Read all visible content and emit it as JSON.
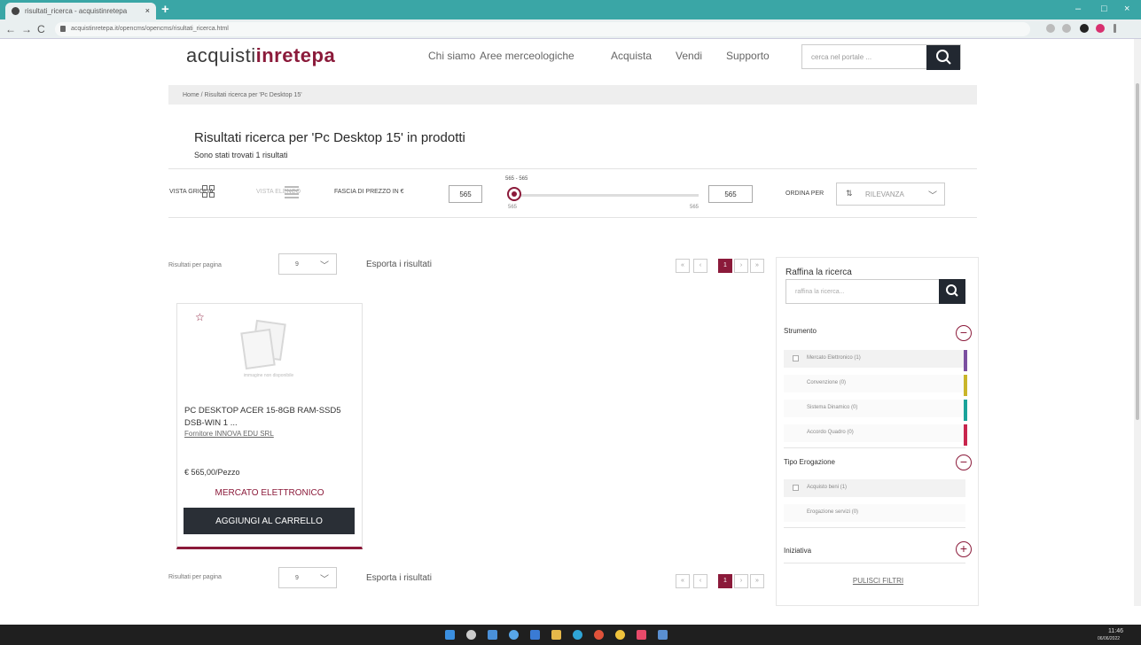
{
  "browser": {
    "tab_title": "risultati_ricerca - acquistinretepa",
    "tab_close": "×",
    "new_tab": "+",
    "url": "acquistinretepa.it/opencms/opencms/risultati_ricerca.html",
    "back": "←",
    "forward": "→",
    "reload": "C",
    "min": "–",
    "max": "□",
    "close": "×"
  },
  "header": {
    "logo_prefix": "acquisti",
    "logo_bold": "inrete",
    "logo_suffix": "pa",
    "nav": [
      "Chi siamo",
      "Aree merceologiche",
      "Acquista",
      "Vendi",
      "Supporto"
    ],
    "search_placeholder": "cerca nel portale ..."
  },
  "breadcrumb": "Home  /  Risultati ricerca per 'Pc Desktop 15'",
  "results": {
    "title": "Risultati ricerca per 'Pc Desktop 15' in prodotti",
    "subtitle": "Sono stati trovati 1 risultati"
  },
  "toolbar": {
    "grid_view": "VISTA GRIGLIA",
    "list_view": "VISTA ELENCO",
    "price_range_label": "FASCIA DI PREZZO IN €",
    "price_min": "565",
    "price_max": "565",
    "slider_label": "565 - 565",
    "slider_min": "565",
    "slider_max": "565",
    "sort_label": "ORDINA PER",
    "sort_value": "RILEVANZA"
  },
  "pagination": {
    "per_page_label": "Risultati per pagina",
    "per_page_value": "9",
    "export": "Esporta i risultati",
    "first": "«",
    "prev": "‹",
    "current": "1",
    "next": "›",
    "last": "»"
  },
  "product": {
    "image_caption": "immagine non disponibile",
    "name": "PC DESKTOP ACER 15-8GB RAM-SSD5 DSB-WIN 1 ...",
    "supplier": "Fornitore INNOVA EDU SRL",
    "price": "€ 565,00/Pezzo",
    "tool": "MERCATO ELETTRONICO",
    "add_to_cart": "AGGIUNGI AL CARRELLO"
  },
  "sidebar": {
    "title": "Raffina la ricerca",
    "search_placeholder": "raffina la ricerca...",
    "facet_strumento": "Strumento",
    "strumento_options": [
      "Mercato Elettronico (1)",
      "Convenzione (0)",
      "Sistema Dinamico (0)",
      "Accordo Quadro (0)"
    ],
    "strumento_colors": [
      "#7b4fa0",
      "#c9b52a",
      "#1aa39a",
      "#c8254d"
    ],
    "facet_tipo": "Tipo Erogazione",
    "tipo_options": [
      "Acquisto beni (1)",
      "Erogazione servizi (0)"
    ],
    "facet_iniziativa": "Iniziativa",
    "collapse": "−",
    "expand": "+",
    "reset": "PULISCI FILTRI"
  },
  "taskbar": {
    "time": "11:46",
    "date": "06/06/2022"
  },
  "colors": {
    "brand": "#8b1a3a",
    "dark": "#2a2f36",
    "browser_frame": "#3aa6a6"
  }
}
